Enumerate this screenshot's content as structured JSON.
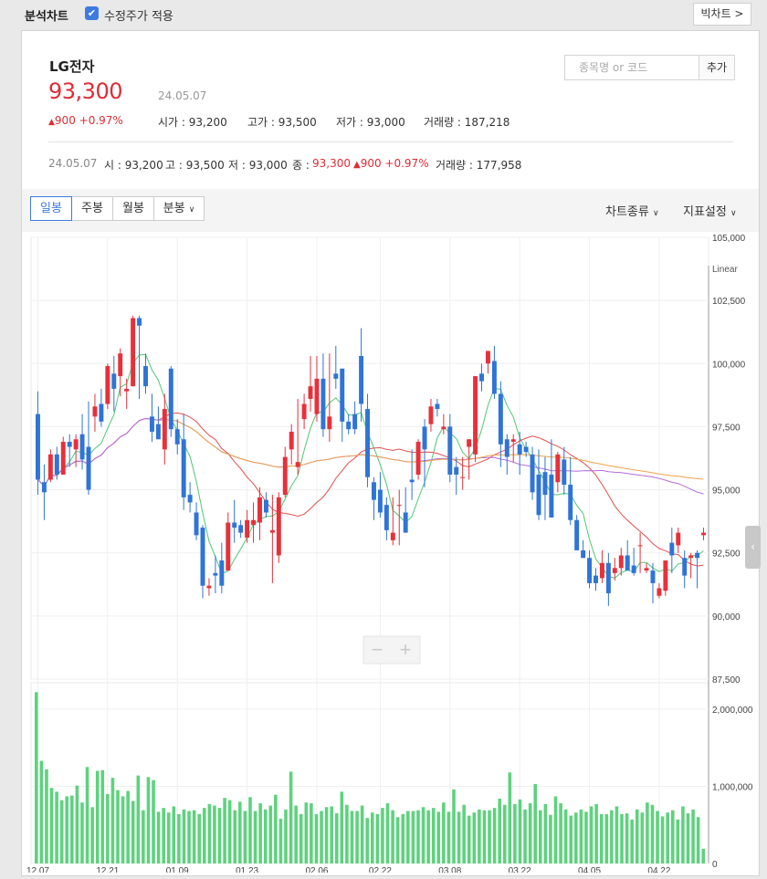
{
  "topbar": {
    "title": "분석차트",
    "adjusted_label": "수정주가 적용",
    "big_chart_label": "빅차트 >"
  },
  "stock": {
    "name": "LG전자",
    "price": "93,300",
    "date": "24.05.07",
    "change": "900 +0.97%",
    "open": "시가 : 93,200",
    "high": "고가 : 93,500",
    "low": "저가 : 93,000",
    "volume": "거래량 : 187,218"
  },
  "search": {
    "placeholder": "종목명 or 코드",
    "add_label": "추가"
  },
  "summary": {
    "date": "24.05.07",
    "open": "시 : 93,200",
    "high": "고 : 93,500",
    "low": "저 : 93,000",
    "close_label": "종 :",
    "close": "93,300",
    "change": "900 +0.97%",
    "volume": "거래량 : 177,958"
  },
  "period_tabs": [
    "일봉",
    "주봉",
    "월봉",
    "분봉"
  ],
  "chart_type_label": "차트종류",
  "indicator_label": "지표설정",
  "colors": {
    "up": "#e8303a",
    "down": "#2f74d6",
    "volume": "#5ed27e",
    "ma5": "#4fc873",
    "ma20": "#e44f4f",
    "ma60": "#b46bde",
    "ma120": "#f0a24a"
  },
  "chart_data": {
    "type": "candlestick",
    "scale_label": "Linear",
    "price_ticks": [
      "105,000",
      "102,500",
      "100,000",
      "97,500",
      "95,000",
      "92,500",
      "90,000",
      "87,500"
    ],
    "volume_ticks": [
      "2,000,000",
      "1,000,000",
      "0"
    ],
    "x_ticks": [
      "12.07",
      "12.21",
      "01.09",
      "01.23",
      "02.06",
      "02.22",
      "03.08",
      "03.22",
      "04.05",
      "04.22"
    ],
    "ylim": [
      87500,
      105000
    ],
    "volume_ylim": [
      0,
      2200000
    ],
    "candles": [
      {
        "o": 98000,
        "h": 98900,
        "l": 94800,
        "c": 95400
      },
      {
        "o": 95300,
        "h": 96000,
        "l": 93800,
        "c": 94900
      },
      {
        "o": 95400,
        "h": 96600,
        "l": 95300,
        "c": 96400
      },
      {
        "o": 96400,
        "h": 96700,
        "l": 95400,
        "c": 95600
      },
      {
        "o": 95600,
        "h": 97100,
        "l": 95600,
        "c": 96900
      },
      {
        "o": 96900,
        "h": 97200,
        "l": 95900,
        "c": 96700
      },
      {
        "o": 96600,
        "h": 97200,
        "l": 95900,
        "c": 97000
      },
      {
        "o": 97200,
        "h": 98000,
        "l": 95800,
        "c": 96200
      },
      {
        "o": 96700,
        "h": 98500,
        "l": 94800,
        "c": 95000
      },
      {
        "o": 97900,
        "h": 98800,
        "l": 97300,
        "c": 98300
      },
      {
        "o": 98400,
        "h": 99000,
        "l": 97500,
        "c": 97700
      },
      {
        "o": 98400,
        "h": 100000,
        "l": 98200,
        "c": 99900
      },
      {
        "o": 99600,
        "h": 100300,
        "l": 98100,
        "c": 99000
      },
      {
        "o": 99500,
        "h": 100600,
        "l": 98700,
        "c": 100400
      },
      {
        "o": 98900,
        "h": 99400,
        "l": 98200,
        "c": 99000
      },
      {
        "o": 99100,
        "h": 101900,
        "l": 99100,
        "c": 101800
      },
      {
        "o": 101800,
        "h": 101900,
        "l": 98600,
        "c": 101500
      },
      {
        "o": 99900,
        "h": 100400,
        "l": 98800,
        "c": 99100
      },
      {
        "o": 97900,
        "h": 98800,
        "l": 96900,
        "c": 97300
      },
      {
        "o": 97600,
        "h": 98300,
        "l": 97000,
        "c": 97000
      },
      {
        "o": 96600,
        "h": 98800,
        "l": 96000,
        "c": 98200
      },
      {
        "o": 99800,
        "h": 99900,
        "l": 97100,
        "c": 97400
      },
      {
        "o": 97400,
        "h": 97800,
        "l": 96400,
        "c": 96800
      },
      {
        "o": 97000,
        "h": 98000,
        "l": 94200,
        "c": 94700
      },
      {
        "o": 94800,
        "h": 95300,
        "l": 94100,
        "c": 94500
      },
      {
        "o": 94100,
        "h": 94500,
        "l": 93000,
        "c": 93200
      },
      {
        "o": 93500,
        "h": 93600,
        "l": 90700,
        "c": 91200
      },
      {
        "o": 91100,
        "h": 91500,
        "l": 90800,
        "c": 91200
      },
      {
        "o": 91700,
        "h": 92400,
        "l": 90900,
        "c": 91600
      },
      {
        "o": 92200,
        "h": 92900,
        "l": 90900,
        "c": 91200
      },
      {
        "o": 91800,
        "h": 94100,
        "l": 91800,
        "c": 93700
      },
      {
        "o": 93700,
        "h": 94600,
        "l": 92900,
        "c": 93500
      },
      {
        "o": 93600,
        "h": 93800,
        "l": 93100,
        "c": 93300
      },
      {
        "o": 93100,
        "h": 94200,
        "l": 92900,
        "c": 93800
      },
      {
        "o": 93600,
        "h": 94500,
        "l": 92900,
        "c": 93800
      },
      {
        "o": 93700,
        "h": 95100,
        "l": 93000,
        "c": 94700
      },
      {
        "o": 94600,
        "h": 94900,
        "l": 93900,
        "c": 94100
      },
      {
        "o": 93300,
        "h": 94800,
        "l": 91300,
        "c": 93400
      },
      {
        "o": 92400,
        "h": 94900,
        "l": 92100,
        "c": 94700
      },
      {
        "o": 94800,
        "h": 96700,
        "l": 94700,
        "c": 96300
      },
      {
        "o": 96600,
        "h": 97600,
        "l": 96000,
        "c": 97300
      },
      {
        "o": 95900,
        "h": 98600,
        "l": 95600,
        "c": 96100
      },
      {
        "o": 97800,
        "h": 98800,
        "l": 97400,
        "c": 98400
      },
      {
        "o": 98600,
        "h": 100300,
        "l": 98100,
        "c": 99100
      },
      {
        "o": 98000,
        "h": 100300,
        "l": 97700,
        "c": 99400
      },
      {
        "o": 99400,
        "h": 100400,
        "l": 97100,
        "c": 97400
      },
      {
        "o": 97400,
        "h": 100400,
        "l": 96900,
        "c": 97900
      },
      {
        "o": 99600,
        "h": 100700,
        "l": 99000,
        "c": 99400
      },
      {
        "o": 99800,
        "h": 99800,
        "l": 96900,
        "c": 97700
      },
      {
        "o": 97700,
        "h": 98000,
        "l": 97200,
        "c": 97400
      },
      {
        "o": 98000,
        "h": 98500,
        "l": 97200,
        "c": 97400
      },
      {
        "o": 100300,
        "h": 101400,
        "l": 97700,
        "c": 98400
      },
      {
        "o": 98200,
        "h": 98800,
        "l": 95100,
        "c": 95500
      },
      {
        "o": 95300,
        "h": 95500,
        "l": 93800,
        "c": 94600
      },
      {
        "o": 95000,
        "h": 95700,
        "l": 93900,
        "c": 94100
      },
      {
        "o": 94400,
        "h": 94700,
        "l": 93000,
        "c": 93400
      },
      {
        "o": 93000,
        "h": 94700,
        "l": 92800,
        "c": 93300
      },
      {
        "o": 94400,
        "h": 95000,
        "l": 92800,
        "c": 94400
      },
      {
        "o": 94100,
        "h": 95100,
        "l": 93400,
        "c": 93300
      },
      {
        "o": 95400,
        "h": 96600,
        "l": 94600,
        "c": 95300
      },
      {
        "o": 95600,
        "h": 97000,
        "l": 95400,
        "c": 96900
      },
      {
        "o": 97500,
        "h": 97800,
        "l": 95100,
        "c": 96600
      },
      {
        "o": 97600,
        "h": 98600,
        "l": 97300,
        "c": 98300
      },
      {
        "o": 98400,
        "h": 98600,
        "l": 97900,
        "c": 98200
      },
      {
        "o": 97400,
        "h": 98000,
        "l": 97200,
        "c": 97500
      },
      {
        "o": 97500,
        "h": 98000,
        "l": 95300,
        "c": 95600
      },
      {
        "o": 95900,
        "h": 96300,
        "l": 94800,
        "c": 95600
      },
      {
        "o": 95500,
        "h": 96300,
        "l": 95000,
        "c": 95500
      },
      {
        "o": 96700,
        "h": 97000,
        "l": 95400,
        "c": 97000
      },
      {
        "o": 96400,
        "h": 99500,
        "l": 96100,
        "c": 99500
      },
      {
        "o": 99600,
        "h": 100000,
        "l": 98900,
        "c": 99300
      },
      {
        "o": 100000,
        "h": 100500,
        "l": 99600,
        "c": 100500
      },
      {
        "o": 100100,
        "h": 100700,
        "l": 98600,
        "c": 98800
      },
      {
        "o": 98800,
        "h": 99300,
        "l": 95900,
        "c": 96800
      },
      {
        "o": 97000,
        "h": 97200,
        "l": 95600,
        "c": 96300
      },
      {
        "o": 96900,
        "h": 97200,
        "l": 96100,
        "c": 97000
      },
      {
        "o": 96800,
        "h": 97300,
        "l": 95600,
        "c": 96400
      },
      {
        "o": 96700,
        "h": 96900,
        "l": 96300,
        "c": 96500
      },
      {
        "o": 96400,
        "h": 96700,
        "l": 94600,
        "c": 94900
      },
      {
        "o": 95600,
        "h": 96600,
        "l": 93800,
        "c": 94000
      },
      {
        "o": 95700,
        "h": 96300,
        "l": 93800,
        "c": 94800
      },
      {
        "o": 95600,
        "h": 97000,
        "l": 93900,
        "c": 93900
      },
      {
        "o": 95300,
        "h": 96500,
        "l": 94900,
        "c": 96400
      },
      {
        "o": 96200,
        "h": 96700,
        "l": 94800,
        "c": 95200
      },
      {
        "o": 95200,
        "h": 96300,
        "l": 93600,
        "c": 93800
      },
      {
        "o": 93800,
        "h": 94000,
        "l": 92600,
        "c": 92600
      },
      {
        "o": 92600,
        "h": 93000,
        "l": 92300,
        "c": 92300
      },
      {
        "o": 92300,
        "h": 92600,
        "l": 91100,
        "c": 91300
      },
      {
        "o": 91600,
        "h": 91900,
        "l": 91000,
        "c": 91300
      },
      {
        "o": 91500,
        "h": 92600,
        "l": 91300,
        "c": 92100
      },
      {
        "o": 92100,
        "h": 92500,
        "l": 90400,
        "c": 90900
      },
      {
        "o": 91700,
        "h": 92300,
        "l": 91400,
        "c": 91900
      },
      {
        "o": 91900,
        "h": 92700,
        "l": 91600,
        "c": 92400
      },
      {
        "o": 92400,
        "h": 93000,
        "l": 91800,
        "c": 91800
      },
      {
        "o": 92000,
        "h": 92700,
        "l": 91600,
        "c": 91700
      },
      {
        "o": 92800,
        "h": 93300,
        "l": 91700,
        "c": 92800
      },
      {
        "o": 91800,
        "h": 92100,
        "l": 91700,
        "c": 91900
      },
      {
        "o": 91800,
        "h": 92100,
        "l": 90500,
        "c": 91300
      },
      {
        "o": 90800,
        "h": 91300,
        "l": 90700,
        "c": 91100
      },
      {
        "o": 91000,
        "h": 92200,
        "l": 90800,
        "c": 92200
      },
      {
        "o": 92900,
        "h": 93500,
        "l": 91700,
        "c": 92400
      },
      {
        "o": 92800,
        "h": 93500,
        "l": 92500,
        "c": 93300
      },
      {
        "o": 92300,
        "h": 92600,
        "l": 91100,
        "c": 91600
      },
      {
        "o": 92300,
        "h": 92500,
        "l": 91500,
        "c": 92400
      },
      {
        "o": 92500,
        "h": 92600,
        "l": 91100,
        "c": 92300
      },
      {
        "o": 93200,
        "h": 93500,
        "l": 93000,
        "c": 93300
      }
    ],
    "volumes": [
      2220000,
      1330000,
      1220000,
      980000,
      930000,
      820000,
      870000,
      880000,
      1010000,
      790000,
      1250000,
      730000,
      1200000,
      1210000,
      900000,
      1110000,
      950000,
      870000,
      940000,
      810000,
      1140000,
      690000,
      1120000,
      1080000,
      670000,
      720000,
      660000,
      740000,
      640000,
      700000,
      680000,
      690000,
      640000,
      720000,
      770000,
      750000,
      720000,
      850000,
      820000,
      690000,
      800000,
      680000,
      860000,
      680000,
      780000,
      700000,
      750000,
      890000,
      580000,
      700000,
      1190000,
      750000,
      640000,
      790000,
      780000,
      640000,
      680000,
      730000,
      740000,
      650000,
      930000,
      760000,
      680000,
      680000,
      750000,
      590000,
      660000,
      640000,
      720000,
      780000,
      690000,
      600000,
      640000,
      680000,
      680000,
      690000,
      730000,
      690000,
      720000,
      670000,
      790000,
      670000,
      960000,
      670000,
      760000,
      620000,
      660000,
      700000,
      690000,
      690000,
      720000,
      840000,
      760000,
      1180000,
      770000,
      830000,
      700000,
      780000,
      1030000,
      690000,
      770000,
      630000,
      870000,
      780000,
      700000,
      620000,
      660000,
      700000,
      670000,
      740000,
      770000,
      640000,
      640000,
      690000,
      740000,
      640000,
      650000,
      570000,
      700000,
      660000,
      790000,
      760000,
      680000,
      610000,
      660000,
      690000,
      570000,
      740000,
      650000,
      700000,
      600000,
      190000
    ],
    "moving_averages": [
      {
        "period": 5,
        "color": "#4fc873"
      },
      {
        "period": 20,
        "color": "#e44f4f"
      },
      {
        "period": 60,
        "color": "#b46bde"
      },
      {
        "period": 120,
        "color": "#f0a24a"
      }
    ]
  }
}
